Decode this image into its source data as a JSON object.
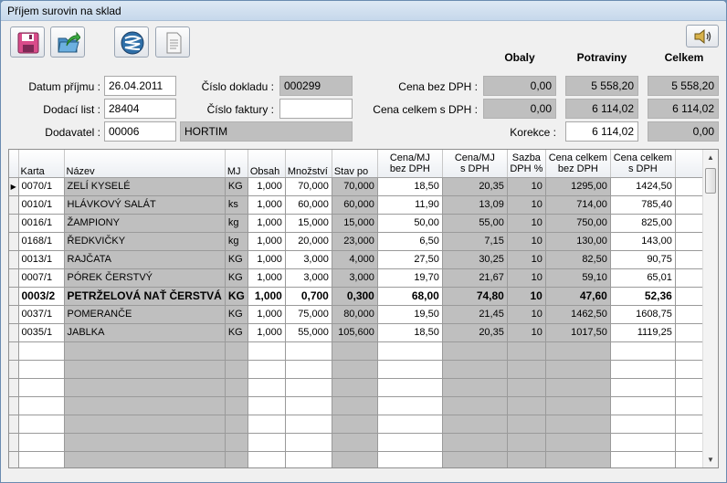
{
  "window": {
    "title": "Příjem surovin na sklad"
  },
  "toolbar": {
    "buttons": [
      {
        "name": "save-button",
        "icon": "floppy-disk-icon"
      },
      {
        "name": "export-button",
        "icon": "folder-arrow-icon"
      },
      {
        "name": "spring-button",
        "icon": "spring-icon"
      },
      {
        "name": "document-button",
        "icon": "document-icon"
      }
    ],
    "sound_button": {
      "icon": "speaker-icon"
    }
  },
  "summary_headers": {
    "obaly": "Obaly",
    "potraviny": "Potraviny",
    "celkem": "Celkem"
  },
  "form": {
    "datum_prijmu_label": "Datum příjmu :",
    "datum_prijmu": "26.04.2011",
    "dodaci_list_label": "Dodací list :",
    "dodaci_list": "28404",
    "dodavatel_label": "Dodavatel :",
    "dodavatel_code": "00006",
    "dodavatel_name": "HORTIM",
    "cislo_dokladu_label": "Číslo dokladu :",
    "cislo_dokladu": "000299",
    "cislo_faktury_label": "Číslo faktury :",
    "cislo_faktury": ""
  },
  "totals": {
    "cena_bez_dph_label": "Cena bez DPH :",
    "cena_celkem_label": "Cena celkem s DPH :",
    "korekce_label": "Korekce :",
    "bez_dph": {
      "obaly": "0,00",
      "potraviny": "5 558,20",
      "celkem": "5 558,20"
    },
    "s_dph": {
      "obaly": "0,00",
      "potraviny": "6 114,02",
      "celkem": "6 114,02"
    },
    "korekce": {
      "potraviny": "6 114,02",
      "celkem": "0,00"
    }
  },
  "grid": {
    "headers": {
      "karta": "Karta",
      "nazev": "Název",
      "mj": "MJ",
      "obsah": "Obsah",
      "mnozstvi": "Množství",
      "stav_po": "Stav po",
      "cena_mj_bez_1": "Cena/MJ",
      "cena_mj_bez_2": "bez DPH",
      "cena_mj_s_1": "Cena/MJ",
      "cena_mj_s_2": "s DPH",
      "sazba_1": "Sazba",
      "sazba_2": "DPH %",
      "celkem_bez_1": "Cena celkem",
      "celkem_bez_2": "bez DPH",
      "celkem_s_1": "Cena celkem",
      "celkem_s_2": "s DPH"
    },
    "current_row_marker": "▶",
    "rows": [
      {
        "karta": "0070/1",
        "nazev": "ZELÍ KYSELÉ",
        "mj": "KG",
        "obsah": "1,000",
        "mnozstvi": "70,000",
        "stav_po": "70,000",
        "cena_bez": "18,50",
        "cena_s": "20,35",
        "sazba": "10",
        "celkem_bez": "1295,00",
        "celkem_s": "1424,50",
        "bold": false
      },
      {
        "karta": "0010/1",
        "nazev": "HLÁVKOVÝ SALÁT",
        "mj": "ks",
        "obsah": "1,000",
        "mnozstvi": "60,000",
        "stav_po": "60,000",
        "cena_bez": "11,90",
        "cena_s": "13,09",
        "sazba": "10",
        "celkem_bez": "714,00",
        "celkem_s": "785,40",
        "bold": false
      },
      {
        "karta": "0016/1",
        "nazev": "ŽAMPIONY",
        "mj": "kg",
        "obsah": "1,000",
        "mnozstvi": "15,000",
        "stav_po": "15,000",
        "cena_bez": "50,00",
        "cena_s": "55,00",
        "sazba": "10",
        "celkem_bez": "750,00",
        "celkem_s": "825,00",
        "bold": false
      },
      {
        "karta": "0168/1",
        "nazev": "ŘEDKVIČKY",
        "mj": "kg",
        "obsah": "1,000",
        "mnozstvi": "20,000",
        "stav_po": "23,000",
        "cena_bez": "6,50",
        "cena_s": "7,15",
        "sazba": "10",
        "celkem_bez": "130,00",
        "celkem_s": "143,00",
        "bold": false
      },
      {
        "karta": "0013/1",
        "nazev": "RAJČATA",
        "mj": "KG",
        "obsah": "1,000",
        "mnozstvi": "3,000",
        "stav_po": "4,000",
        "cena_bez": "27,50",
        "cena_s": "30,25",
        "sazba": "10",
        "celkem_bez": "82,50",
        "celkem_s": "90,75",
        "bold": false
      },
      {
        "karta": "0007/1",
        "nazev": "PÓREK ČERSTVÝ",
        "mj": "KG",
        "obsah": "1,000",
        "mnozstvi": "3,000",
        "stav_po": "3,000",
        "cena_bez": "19,70",
        "cena_s": "21,67",
        "sazba": "10",
        "celkem_bez": "59,10",
        "celkem_s": "65,01",
        "bold": false
      },
      {
        "karta": "0003/2",
        "nazev": "PETRŽELOVÁ NAŤ ČERSTVÁ",
        "mj": "KG",
        "obsah": "1,000",
        "mnozstvi": "0,700",
        "stav_po": "0,300",
        "cena_bez": "68,00",
        "cena_s": "74,80",
        "sazba": "10",
        "celkem_bez": "47,60",
        "celkem_s": "52,36",
        "bold": true
      },
      {
        "karta": "0037/1",
        "nazev": "POMERANČE",
        "mj": "KG",
        "obsah": "1,000",
        "mnozstvi": "75,000",
        "stav_po": "80,000",
        "cena_bez": "19,50",
        "cena_s": "21,45",
        "sazba": "10",
        "celkem_bez": "1462,50",
        "celkem_s": "1608,75",
        "bold": false
      },
      {
        "karta": "0035/1",
        "nazev": "JABLKA",
        "mj": "KG",
        "obsah": "1,000",
        "mnozstvi": "55,000",
        "stav_po": "105,600",
        "cena_bez": "18,50",
        "cena_s": "20,35",
        "sazba": "10",
        "celkem_bez": "1017,50",
        "celkem_s": "1119,25",
        "bold": false
      }
    ],
    "empty_rows": 7,
    "scrollbar": {
      "up": "▲",
      "down": "▼"
    }
  }
}
